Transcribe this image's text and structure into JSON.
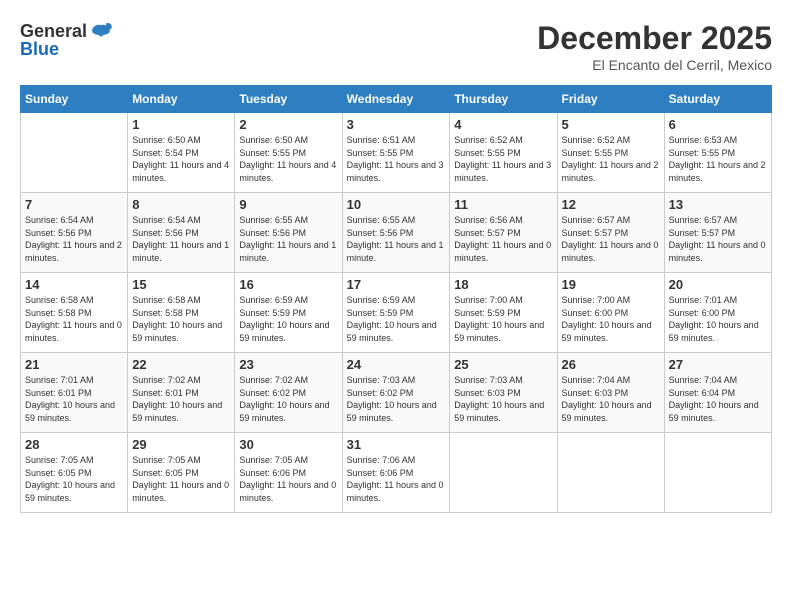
{
  "header": {
    "logo_general": "General",
    "logo_blue": "Blue",
    "month": "December 2025",
    "location": "El Encanto del Cerril, Mexico"
  },
  "weekdays": [
    "Sunday",
    "Monday",
    "Tuesday",
    "Wednesday",
    "Thursday",
    "Friday",
    "Saturday"
  ],
  "weeks": [
    [
      {
        "day": "",
        "info": ""
      },
      {
        "day": "1",
        "info": "Sunrise: 6:50 AM\nSunset: 5:54 PM\nDaylight: 11 hours\nand 4 minutes."
      },
      {
        "day": "2",
        "info": "Sunrise: 6:50 AM\nSunset: 5:55 PM\nDaylight: 11 hours\nand 4 minutes."
      },
      {
        "day": "3",
        "info": "Sunrise: 6:51 AM\nSunset: 5:55 PM\nDaylight: 11 hours\nand 3 minutes."
      },
      {
        "day": "4",
        "info": "Sunrise: 6:52 AM\nSunset: 5:55 PM\nDaylight: 11 hours\nand 3 minutes."
      },
      {
        "day": "5",
        "info": "Sunrise: 6:52 AM\nSunset: 5:55 PM\nDaylight: 11 hours\nand 2 minutes."
      },
      {
        "day": "6",
        "info": "Sunrise: 6:53 AM\nSunset: 5:55 PM\nDaylight: 11 hours\nand 2 minutes."
      }
    ],
    [
      {
        "day": "7",
        "info": "Sunrise: 6:54 AM\nSunset: 5:56 PM\nDaylight: 11 hours\nand 2 minutes."
      },
      {
        "day": "8",
        "info": "Sunrise: 6:54 AM\nSunset: 5:56 PM\nDaylight: 11 hours\nand 1 minute."
      },
      {
        "day": "9",
        "info": "Sunrise: 6:55 AM\nSunset: 5:56 PM\nDaylight: 11 hours\nand 1 minute."
      },
      {
        "day": "10",
        "info": "Sunrise: 6:55 AM\nSunset: 5:56 PM\nDaylight: 11 hours\nand 1 minute."
      },
      {
        "day": "11",
        "info": "Sunrise: 6:56 AM\nSunset: 5:57 PM\nDaylight: 11 hours\nand 0 minutes."
      },
      {
        "day": "12",
        "info": "Sunrise: 6:57 AM\nSunset: 5:57 PM\nDaylight: 11 hours\nand 0 minutes."
      },
      {
        "day": "13",
        "info": "Sunrise: 6:57 AM\nSunset: 5:57 PM\nDaylight: 11 hours\nand 0 minutes."
      }
    ],
    [
      {
        "day": "14",
        "info": "Sunrise: 6:58 AM\nSunset: 5:58 PM\nDaylight: 11 hours\nand 0 minutes."
      },
      {
        "day": "15",
        "info": "Sunrise: 6:58 AM\nSunset: 5:58 PM\nDaylight: 10 hours\nand 59 minutes."
      },
      {
        "day": "16",
        "info": "Sunrise: 6:59 AM\nSunset: 5:59 PM\nDaylight: 10 hours\nand 59 minutes."
      },
      {
        "day": "17",
        "info": "Sunrise: 6:59 AM\nSunset: 5:59 PM\nDaylight: 10 hours\nand 59 minutes."
      },
      {
        "day": "18",
        "info": "Sunrise: 7:00 AM\nSunset: 5:59 PM\nDaylight: 10 hours\nand 59 minutes."
      },
      {
        "day": "19",
        "info": "Sunrise: 7:00 AM\nSunset: 6:00 PM\nDaylight: 10 hours\nand 59 minutes."
      },
      {
        "day": "20",
        "info": "Sunrise: 7:01 AM\nSunset: 6:00 PM\nDaylight: 10 hours\nand 59 minutes."
      }
    ],
    [
      {
        "day": "21",
        "info": "Sunrise: 7:01 AM\nSunset: 6:01 PM\nDaylight: 10 hours\nand 59 minutes."
      },
      {
        "day": "22",
        "info": "Sunrise: 7:02 AM\nSunset: 6:01 PM\nDaylight: 10 hours\nand 59 minutes."
      },
      {
        "day": "23",
        "info": "Sunrise: 7:02 AM\nSunset: 6:02 PM\nDaylight: 10 hours\nand 59 minutes."
      },
      {
        "day": "24",
        "info": "Sunrise: 7:03 AM\nSunset: 6:02 PM\nDaylight: 10 hours\nand 59 minutes."
      },
      {
        "day": "25",
        "info": "Sunrise: 7:03 AM\nSunset: 6:03 PM\nDaylight: 10 hours\nand 59 minutes."
      },
      {
        "day": "26",
        "info": "Sunrise: 7:04 AM\nSunset: 6:03 PM\nDaylight: 10 hours\nand 59 minutes."
      },
      {
        "day": "27",
        "info": "Sunrise: 7:04 AM\nSunset: 6:04 PM\nDaylight: 10 hours\nand 59 minutes."
      }
    ],
    [
      {
        "day": "28",
        "info": "Sunrise: 7:05 AM\nSunset: 6:05 PM\nDaylight: 10 hours\nand 59 minutes."
      },
      {
        "day": "29",
        "info": "Sunrise: 7:05 AM\nSunset: 6:05 PM\nDaylight: 11 hours\nand 0 minutes."
      },
      {
        "day": "30",
        "info": "Sunrise: 7:05 AM\nSunset: 6:06 PM\nDaylight: 11 hours\nand 0 minutes."
      },
      {
        "day": "31",
        "info": "Sunrise: 7:06 AM\nSunset: 6:06 PM\nDaylight: 11 hours\nand 0 minutes."
      },
      {
        "day": "",
        "info": ""
      },
      {
        "day": "",
        "info": ""
      },
      {
        "day": "",
        "info": ""
      }
    ]
  ]
}
